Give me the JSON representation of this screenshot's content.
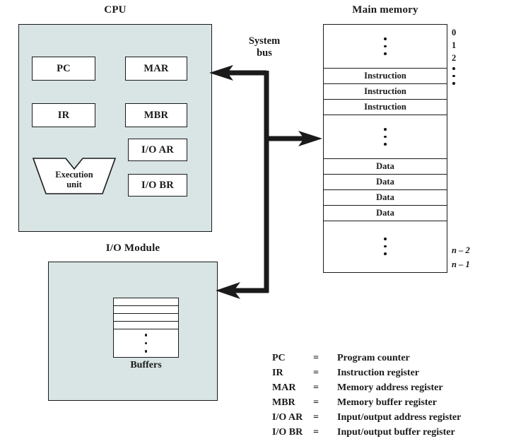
{
  "figure": {
    "cpu": {
      "title": "CPU",
      "registers_left": [
        {
          "label": "PC"
        },
        {
          "label": "IR"
        }
      ],
      "registers_right": [
        {
          "label": "MAR"
        },
        {
          "label": "MBR"
        },
        {
          "label": "I/O AR"
        },
        {
          "label": "I/O BR"
        }
      ],
      "execution_unit": {
        "line1": "Execution",
        "line2": "unit"
      }
    },
    "bus": {
      "line1": "System",
      "line2": "bus"
    },
    "memory": {
      "title": "Main memory",
      "cells": [
        {
          "type": "dots",
          "text": ""
        },
        {
          "type": "text",
          "text": "Instruction"
        },
        {
          "type": "text",
          "text": "Instruction"
        },
        {
          "type": "text",
          "text": "Instruction"
        },
        {
          "type": "dots",
          "text": ""
        },
        {
          "type": "text",
          "text": "Data"
        },
        {
          "type": "text",
          "text": "Data"
        },
        {
          "type": "text",
          "text": "Data"
        },
        {
          "type": "text",
          "text": "Data"
        },
        {
          "type": "dots",
          "text": ""
        }
      ],
      "addresses_top": [
        "0",
        "1",
        "2"
      ],
      "addresses_bottom": [
        "n – 2",
        "n – 1"
      ]
    },
    "io_module": {
      "title": "I/O Module",
      "buffers_label": "Buffers"
    },
    "legend": [
      {
        "abbr": "PC",
        "eq": "=",
        "desc": "Program counter"
      },
      {
        "abbr": "IR",
        "eq": "=",
        "desc": "Instruction register"
      },
      {
        "abbr": "MAR",
        "eq": "=",
        "desc": "Memory address register"
      },
      {
        "abbr": "MBR",
        "eq": "=",
        "desc": "Memory buffer register"
      },
      {
        "abbr": "I/O AR",
        "eq": "=",
        "desc": "Input/output address register"
      },
      {
        "abbr": "I/O BR",
        "eq": "=",
        "desc": "Input/output buffer register"
      }
    ],
    "colors": {
      "block_fill": "#d8e5e4",
      "stroke": "#1a1a1a",
      "register_fill": "#ffffff"
    }
  }
}
